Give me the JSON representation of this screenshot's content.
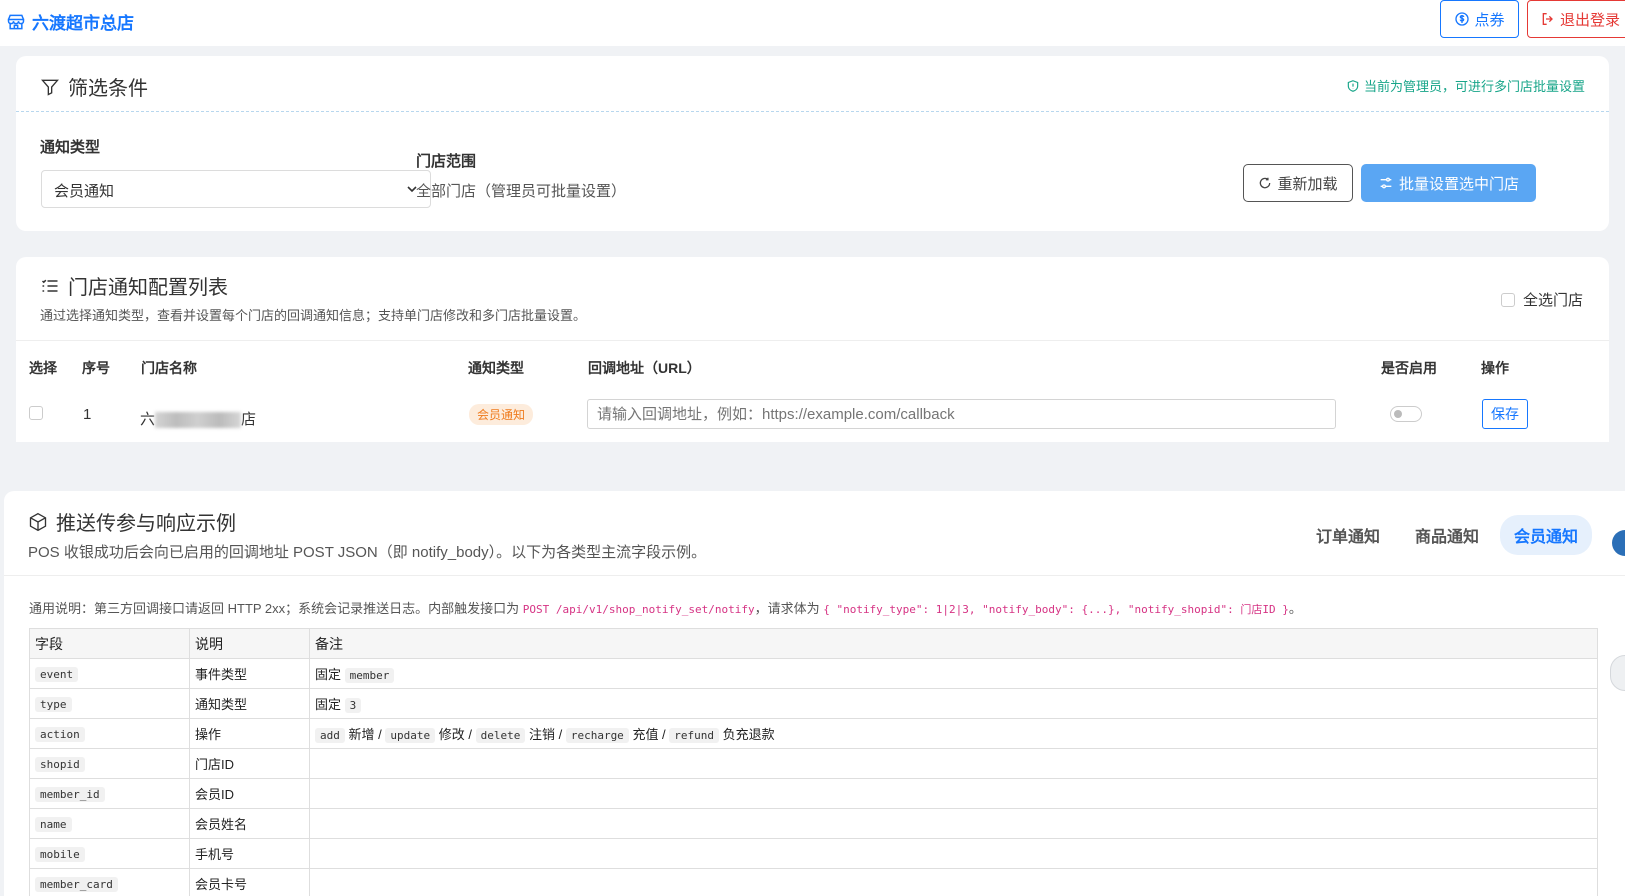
{
  "header": {
    "brand": "六渡超市总店",
    "coupon_label": "点券",
    "logout_label": "退出登录"
  },
  "filter": {
    "title": "筛选条件",
    "admin_note": "当前为管理员，可进行多门店批量设置",
    "notify_type_label": "通知类型",
    "notify_type_value": "会员通知",
    "scope_label": "门店范围",
    "scope_value": "全部门店（管理员可批量设置）",
    "reload_label": "重新加载",
    "batch_label": "批量设置选中门店"
  },
  "store_list": {
    "title": "门店通知配置列表",
    "subtitle": "通过选择通知类型，查看并设置每个门店的回调通知信息；支持单门店修改和多门店批量设置。",
    "select_all_label": "全选门店",
    "columns": [
      "选择",
      "序号",
      "门店名称",
      "通知类型",
      "回调地址（URL）",
      "是否启用",
      "操作"
    ],
    "rows": [
      {
        "index": "1",
        "name_start": "六",
        "name_end": "店",
        "type_badge": "会员通知",
        "url_placeholder": "请输入回调地址，例如：https://example.com/callback",
        "save_label": "保存"
      }
    ]
  },
  "push_example": {
    "title": "推送传参与响应示例",
    "subtitle": "POS 收银成功后会向已启用的回调地址 POST JSON（即 notify_body）。以下为各类型主流字段示例。",
    "tabs": [
      "订单通知",
      "商品通知",
      "会员通知"
    ],
    "active_tab": "会员通知",
    "general_note_prefix": "通用说明：第三方回调接口请返回 HTTP 2xx；系统会记录推送日志。内部触发接口为 ",
    "general_note_endpoint": "POST /api/v1/shop_notify_set/notify",
    "general_note_mid": "，请求体为 ",
    "general_note_body": "{ \"notify_type\": 1|2|3, \"notify_body\": {...}, \"notify_shopid\": 门店ID }",
    "general_note_suffix": "。",
    "table_headers": [
      "字段",
      "说明",
      "备注"
    ],
    "fields": [
      {
        "field": "event",
        "desc": "事件类型"
      },
      {
        "field": "type",
        "desc": "通知类型"
      },
      {
        "field": "action",
        "desc": "操作"
      },
      {
        "field": "shopid",
        "desc": "门店ID"
      },
      {
        "field": "member_id",
        "desc": "会员ID"
      },
      {
        "field": "name",
        "desc": "会员姓名"
      },
      {
        "field": "mobile",
        "desc": "手机号"
      },
      {
        "field": "member_card",
        "desc": "会员卡号"
      }
    ],
    "notes": {
      "event_fixed": "固定",
      "event_value": "member",
      "type_fixed": "固定",
      "type_value": "3",
      "actions": [
        {
          "code": "add",
          "label": "新增 /"
        },
        {
          "code": "update",
          "label": "修改 /"
        },
        {
          "code": "delete",
          "label": "注销 /"
        },
        {
          "code": "recharge",
          "label": "充值 /"
        },
        {
          "code": "refund",
          "label": "负充退款"
        }
      ]
    }
  },
  "colors": {
    "accent": "#1677ff",
    "danger": "#e53935",
    "success_note": "#17a589",
    "badge_orange": "#ef7c1f",
    "batch_button": "#5aa6f3"
  }
}
